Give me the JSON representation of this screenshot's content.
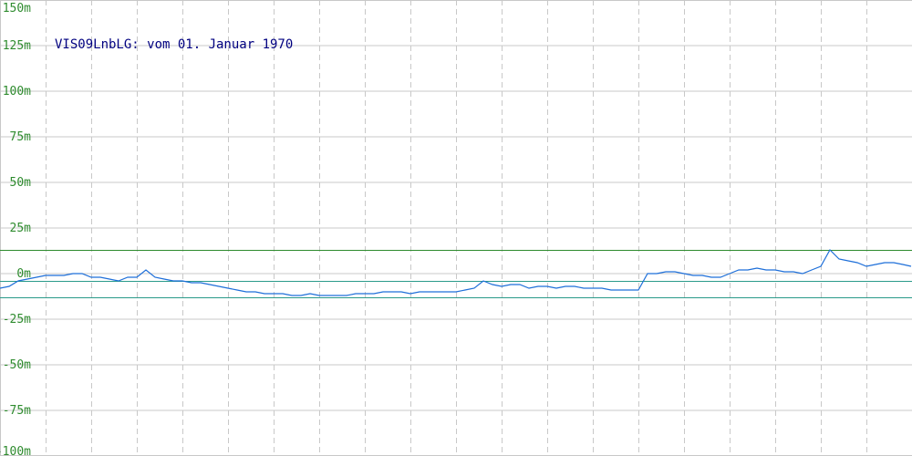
{
  "chart_data": {
    "type": "line",
    "title": "VIS09LnbLG: vom 01. Januar 1970",
    "xlabel": "",
    "ylabel": "",
    "ylim": [
      -100,
      150
    ],
    "y_ticks": [
      150,
      125,
      100,
      75,
      50,
      25,
      0,
      -25,
      -50,
      -75,
      -100
    ],
    "y_tick_labels": [
      "150m",
      "125m",
      "100m",
      "75m",
      "50m",
      "25m",
      "0m",
      "-25m",
      "-50m",
      "-75m",
      "-100m"
    ],
    "grid": true,
    "x_gridlines": 20,
    "reference_lines": [
      13,
      -4,
      -13
    ],
    "x": [
      0,
      10,
      20,
      30,
      40,
      50,
      60,
      70,
      80,
      90,
      100,
      110,
      120,
      130,
      140,
      150,
      160,
      170,
      180,
      190,
      200,
      210,
      220,
      230,
      240,
      250,
      260,
      270,
      280,
      290,
      300,
      310,
      320,
      330,
      340,
      350,
      360,
      370,
      380,
      390,
      400,
      410,
      420,
      430,
      440,
      450,
      460,
      470,
      480,
      490,
      500,
      510,
      520,
      530,
      540,
      550,
      560,
      570,
      580,
      590,
      600,
      610,
      620,
      630,
      640,
      650,
      660,
      670,
      680,
      690,
      700,
      710,
      720,
      730,
      740,
      750,
      760,
      770,
      780,
      790,
      800,
      810,
      820,
      830,
      840,
      850,
      860,
      870,
      880,
      890,
      900,
      910,
      920,
      930,
      940,
      950,
      960,
      970,
      980,
      990,
      999
    ],
    "series": [
      {
        "color": "#1e6fd9",
        "values": [
          -8,
          -7,
          -4,
          -3,
          -2,
          -1,
          -1,
          -1,
          0,
          0,
          -2,
          -2,
          -3,
          -4,
          -2,
          -2,
          2,
          -2,
          -3,
          -4,
          -4,
          -5,
          -5,
          -6,
          -7,
          -8,
          -9,
          -10,
          -10,
          -11,
          -11,
          -11,
          -12,
          -12,
          -11,
          -12,
          -12,
          -12,
          -12,
          -11,
          -11,
          -11,
          -10,
          -10,
          -10,
          -11,
          -10,
          -10,
          -10,
          -10,
          -10,
          -9,
          -8,
          -4,
          -6,
          -7,
          -6,
          -6,
          -8,
          -7,
          -7,
          -8,
          -7,
          -7,
          -8,
          -8,
          -8,
          -9,
          -9,
          -9,
          -9,
          0,
          0,
          1,
          1,
          0,
          -1,
          -1,
          -2,
          -2,
          0,
          2,
          2,
          3,
          2,
          2,
          1,
          1,
          0,
          2,
          4,
          13,
          8,
          7,
          6,
          4,
          5,
          6,
          6,
          5,
          4
        ]
      }
    ]
  }
}
